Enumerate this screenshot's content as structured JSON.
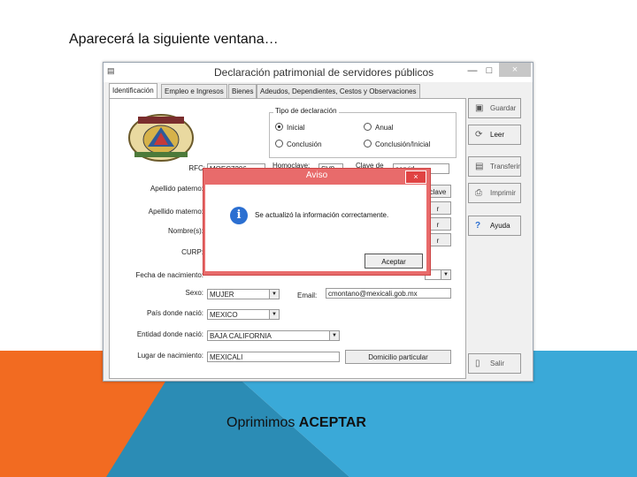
{
  "slide": {
    "title": "Aparecerá la siguiente ventana…",
    "caption_prefix": "Oprimimos ",
    "caption_bold": "ACEPTAR",
    "colors": {
      "orange": "#f26b21",
      "teal": "#3aa9d8",
      "dark_teal": "#2b8cb5"
    }
  },
  "window": {
    "title": "Declaración patrimonial de servidores públicos",
    "minimize": "—",
    "maximize": "□",
    "close": "×",
    "tabs": [
      "Identificación",
      "Empleo e Ingresos",
      "Bienes",
      "Adeudos, Dependientes, Cestos y Observaciones"
    ]
  },
  "form": {
    "tipo_declaracion": {
      "legend": "Tipo de declaración",
      "options": [
        "Inicial",
        "Anual",
        "Conclusión",
        "Conclusión/Inicial"
      ],
      "selected": "Inicial"
    },
    "rfc_label": "RFC:",
    "rfc_value": "MOEC7206",
    "homoclave_label": "Homoclave:",
    "homoclave_value": "SV8",
    "clave_label": "Clave de",
    "clave_value": "servid",
    "apellido_paterno_label": "Apellido paterno:",
    "apellido_materno_label": "Apellido materno:",
    "nombre_label": "Nombre(s):",
    "curp_label": "CURP:",
    "fecha_label": "Fecha de nacimiento:",
    "sexo_label": "Sexo:",
    "sexo_value": "MUJER",
    "email_label": "Email:",
    "email_value": "cmontano@mexicali.gob.mx",
    "pais_label": "País donde nació:",
    "pais_value": "MEXICO",
    "entidad_label": "Entidad donde nació:",
    "entidad_value": "BAJA CALIFORNIA",
    "lugar_label": "Lugar de nacimiento:",
    "lugar_value": "MEXICALI",
    "domicilio_button": "Domicilio particular",
    "clave_button": "clave",
    "side_partial": [
      "r",
      "r",
      "r"
    ]
  },
  "actions": {
    "guardar": "Guardar",
    "leer": "Leer",
    "transferir": "Transferir",
    "imprimir": "Imprimir",
    "ayuda": "Ayuda",
    "salir": "Salir"
  },
  "dialog": {
    "title": "Aviso",
    "close": "×",
    "message": "Se actualizó la información correctamente.",
    "ok_label": "Aceptar"
  }
}
